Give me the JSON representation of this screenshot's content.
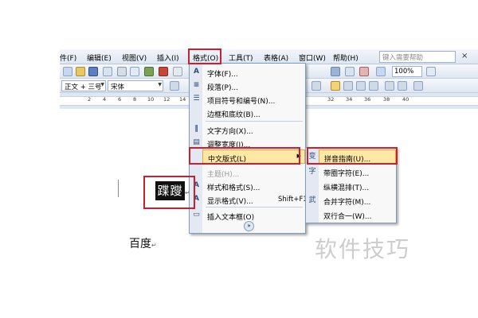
{
  "menubar": {
    "items": [
      "件(F)",
      "编辑(E)",
      "视图(V)",
      "插入(I)",
      "格式(O)",
      "工具(T)",
      "表格(A)",
      "窗口(W)",
      "帮助(H)"
    ],
    "help_placeholder": "键入需要帮助",
    "close": "×"
  },
  "toolbar2": {
    "style_value": "正文 + 三号",
    "font_value": "宋体"
  },
  "toolbar1": {
    "zoom": "100%"
  },
  "ruler": {
    "ticks": [
      "2",
      "4",
      "6",
      "8",
      "10",
      "12",
      "14",
      "32",
      "34",
      "36",
      "38",
      "40"
    ]
  },
  "format_menu": {
    "items": [
      {
        "label": "字体(F)...",
        "icon": "A"
      },
      {
        "label": "段落(P)...",
        "icon": "≡"
      },
      {
        "label": "项目符号和编号(N)...",
        "icon": "☰"
      },
      {
        "label": "边框和底纹(B)...",
        "icon": ""
      },
      {
        "label": "文字方向(X)...",
        "icon": "‖"
      },
      {
        "label": "调整宽度(I)...",
        "icon": "▤"
      },
      {
        "label": "中文版式(L)",
        "icon": ""
      },
      {
        "label": "主题(H)...",
        "icon": ""
      },
      {
        "label": "样式和格式(S)...",
        "icon": "A"
      },
      {
        "label": "显示格式(V)...",
        "icon": "A"
      },
      {
        "label": "插入文本框(O)",
        "icon": "▭"
      }
    ],
    "shortcut": "Shift+F1",
    "expand": "»"
  },
  "chinese_layout_submenu": {
    "items": [
      {
        "label": "拼音指南(U)...",
        "icon": "变"
      },
      {
        "label": "带圈字符(E)...",
        "icon": "字"
      },
      {
        "label": "纵横混排(T)...",
        "icon": ""
      },
      {
        "label": "合并字符(M)...",
        "icon": "武"
      },
      {
        "label": "双行合一(W)...",
        "icon": ""
      }
    ]
  },
  "document": {
    "selected_text": "蹀躞",
    "paragraph_mark": "↵",
    "body_text": "百度"
  },
  "watermark": "软件技巧",
  "colors": {
    "highlight": "#ffe8a6",
    "annotation_red": "#c8202f",
    "menu_border": "#7f9db9"
  }
}
